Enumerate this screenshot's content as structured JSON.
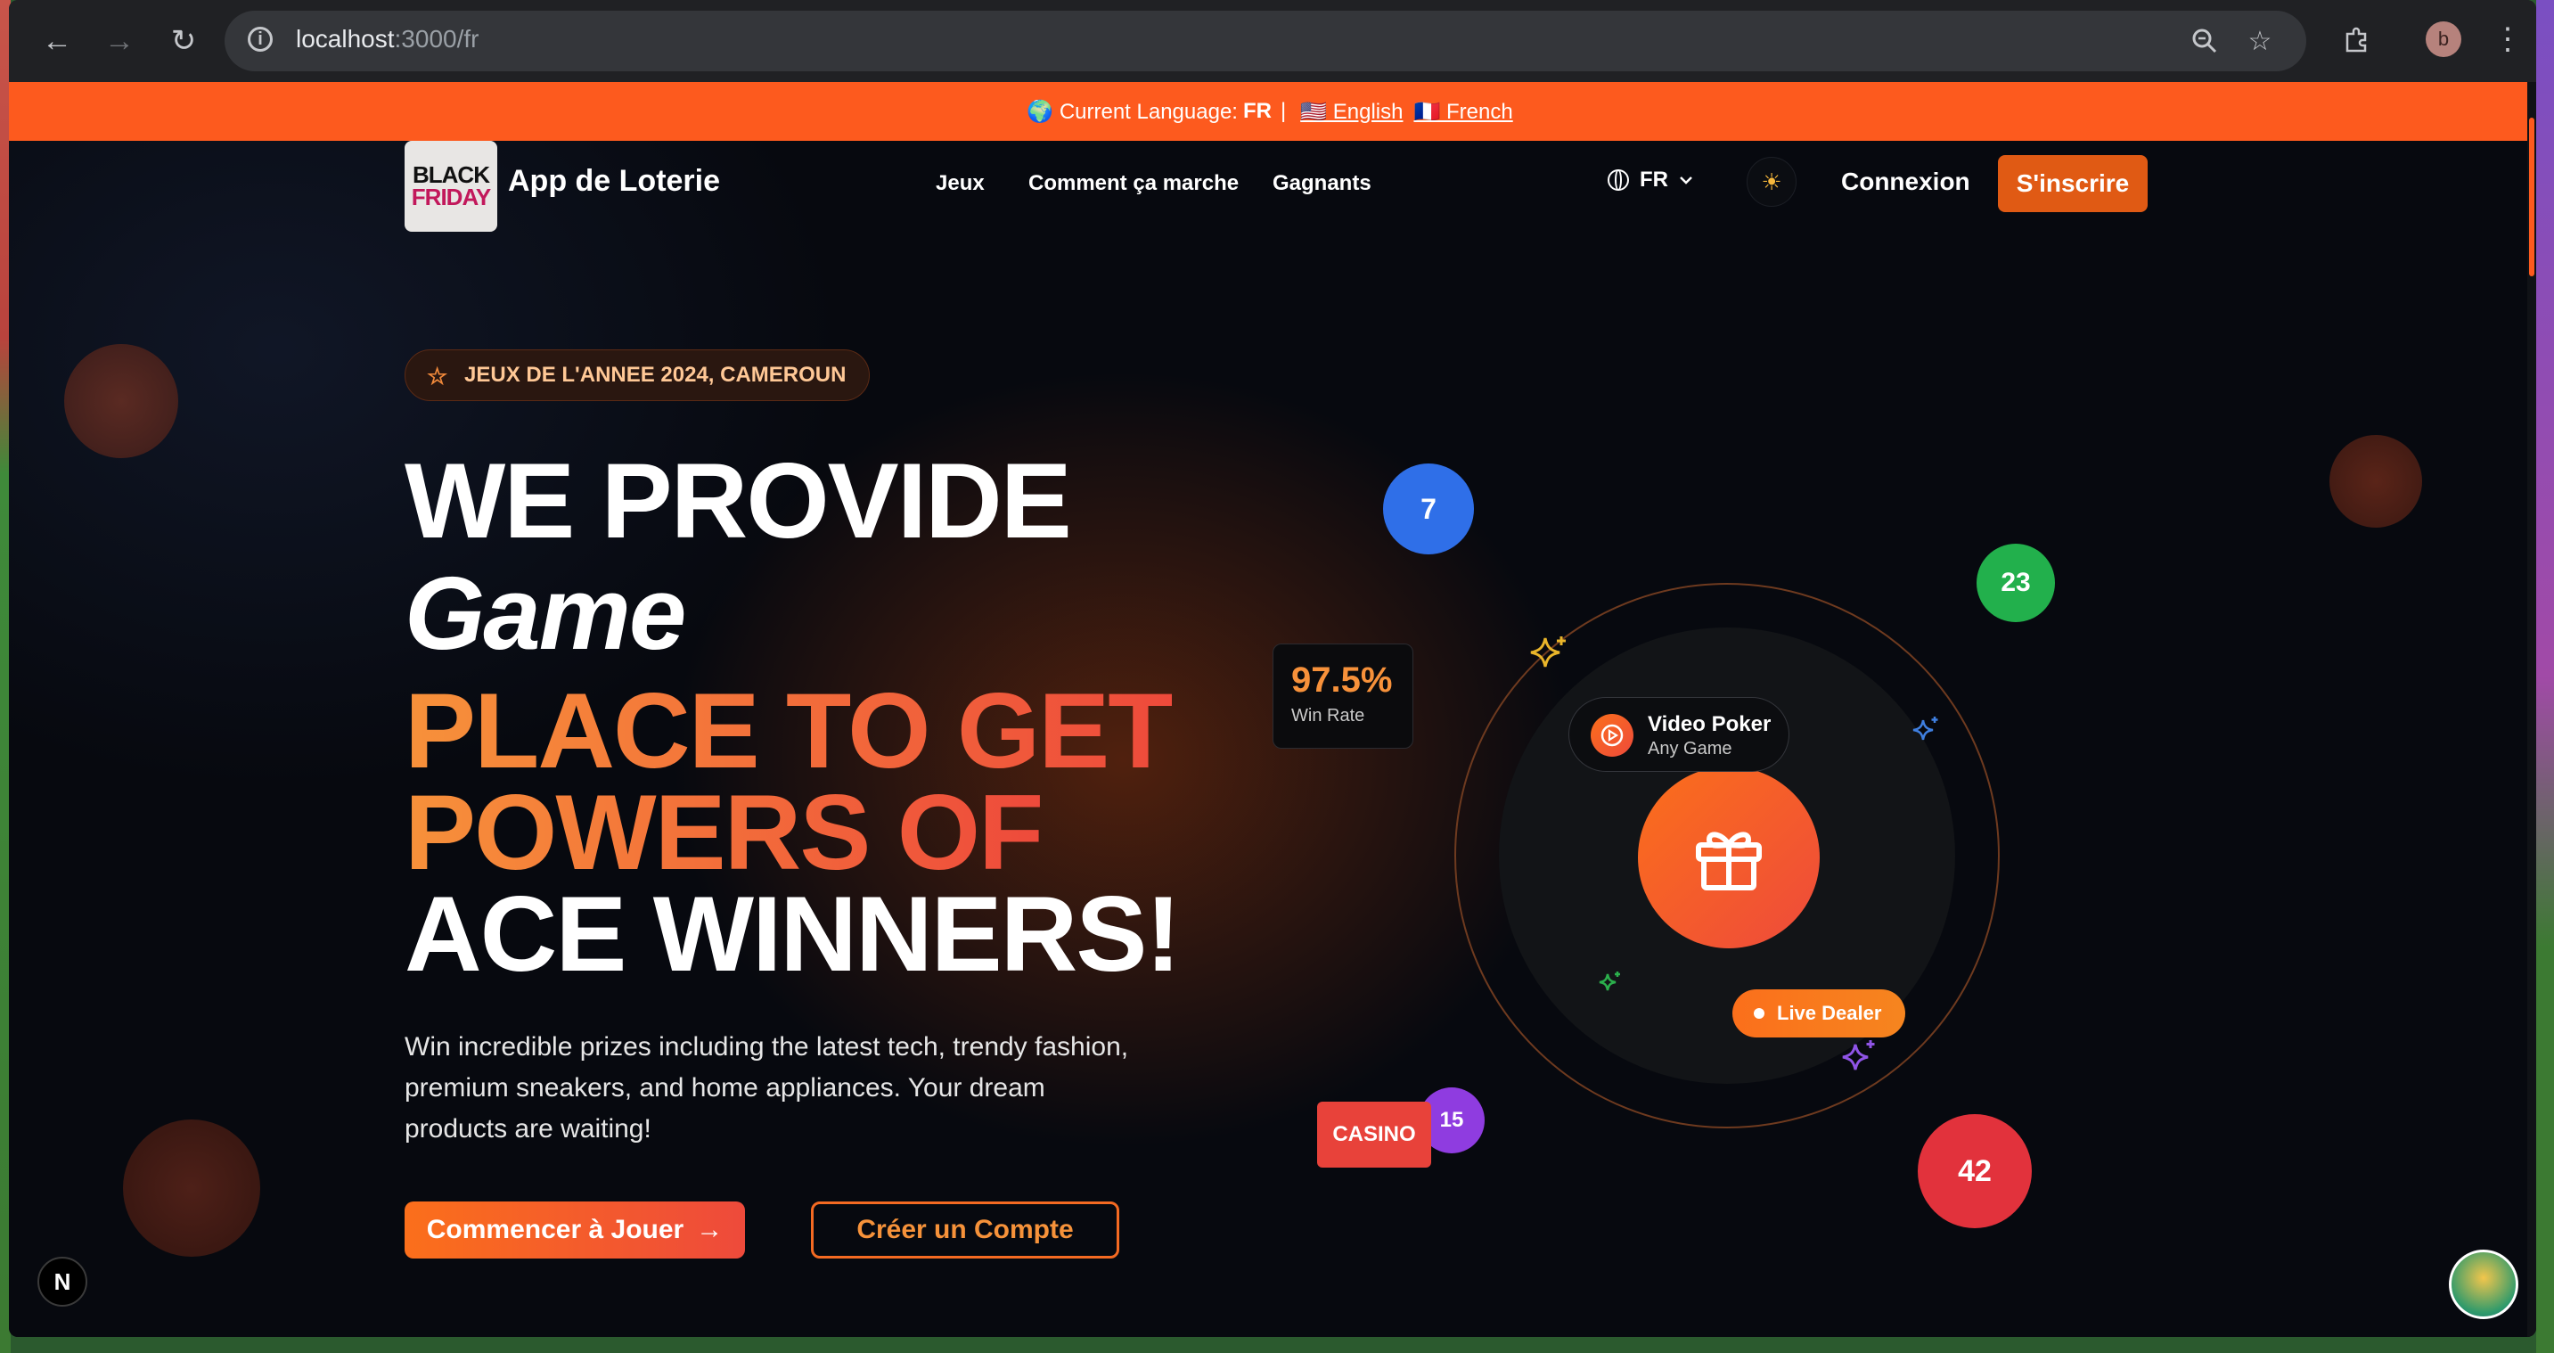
{
  "browser": {
    "url_host": "localhost",
    "url_path": ":3000/fr",
    "profile_initial": "b"
  },
  "lang_bar": {
    "prefix": "🌍 Current Language:",
    "current": "FR",
    "separator": "|",
    "english": "🇺🇸 English",
    "french": "🇫🇷 French"
  },
  "header": {
    "logo_line1": "BLACK",
    "logo_line2": "FRIDAY",
    "brand": "App de Loterie",
    "nav": [
      "Jeux",
      "Comment ça marche",
      "Gagnants"
    ],
    "lang": "FR",
    "theme_icon": "☀",
    "login": "Connexion",
    "signup": "S'inscrire"
  },
  "hero": {
    "badge": "JEUX DE L'ANNEE 2024, CAMEROUN",
    "line1": "WE PROVIDE",
    "line2": "Game",
    "line3": "PLACE TO GET",
    "line4": "POWERS OF",
    "line5": "ACE WINNERS!",
    "description": "Win incredible prizes including the latest tech, trendy fashion, premium sneakers, and home appliances. Your dream products are waiting!",
    "cta_primary": "Commencer à Jouer",
    "cta_secondary": "Créer un Compte"
  },
  "visual": {
    "balls": [
      "7",
      "23",
      "15",
      "42"
    ],
    "win_rate_value": "97.5%",
    "win_rate_label": "Win Rate",
    "video_poker_title": "Video Poker",
    "video_poker_sub": "Any Game",
    "live_dealer": "Live Dealer",
    "casino": "CASINO"
  },
  "overlay": {
    "next_badge": "N"
  },
  "colors": {
    "accent": "#fd5a1e",
    "gradient_start": "#f7913a",
    "gradient_end": "#ee4a3b",
    "ball_blue": "#2f6fe8",
    "ball_green": "#22b04c",
    "ball_purple": "#8f3ce0",
    "ball_red": "#e2323c"
  }
}
